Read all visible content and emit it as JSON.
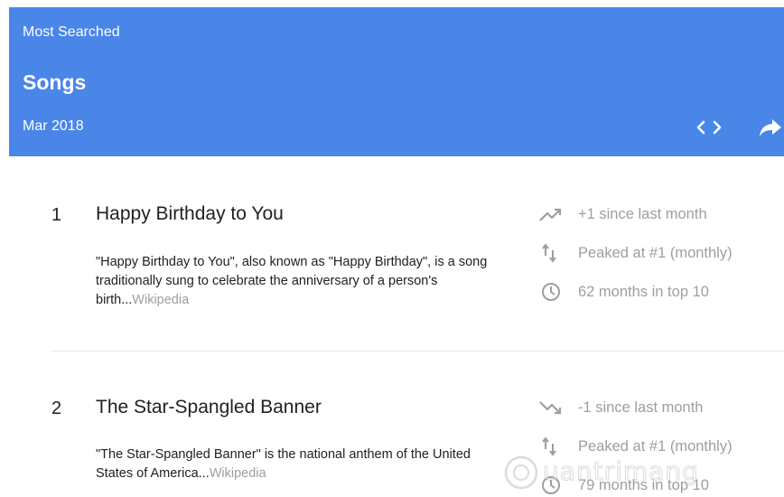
{
  "header": {
    "subtitle": "Most Searched",
    "title": "Songs",
    "date": "Mar 2018",
    "embed_icon": "embed-code-icon",
    "share_icon": "share-arrow-icon",
    "color": "#4a86e8"
  },
  "songs": [
    {
      "rank": "1",
      "title": "Happy Birthday to You",
      "description": "\"Happy Birthday to You\", also known as \"Happy Birthday\", is a song traditionally sung to celebrate the anniversary of a person's birth...",
      "source": "Wikipedia",
      "stats": [
        {
          "icon": "trending-up-icon",
          "text": "+1 since last month"
        },
        {
          "icon": "peak-arrows-icon",
          "text": "Peaked at #1 (monthly)"
        },
        {
          "icon": "clock-icon",
          "text": "62 months in top 10"
        }
      ]
    },
    {
      "rank": "2",
      "title": "The Star-Spangled Banner",
      "description": "\"The Star-Spangled Banner\" is the national anthem of the United States of America...",
      "source": "Wikipedia",
      "stats": [
        {
          "icon": "trending-down-icon",
          "text": "-1 since last month"
        },
        {
          "icon": "peak-arrows-icon",
          "text": "Peaked at #1 (monthly)"
        },
        {
          "icon": "clock-icon",
          "text": "79 months in top 10"
        }
      ]
    }
  ],
  "watermark": "uantrimang"
}
